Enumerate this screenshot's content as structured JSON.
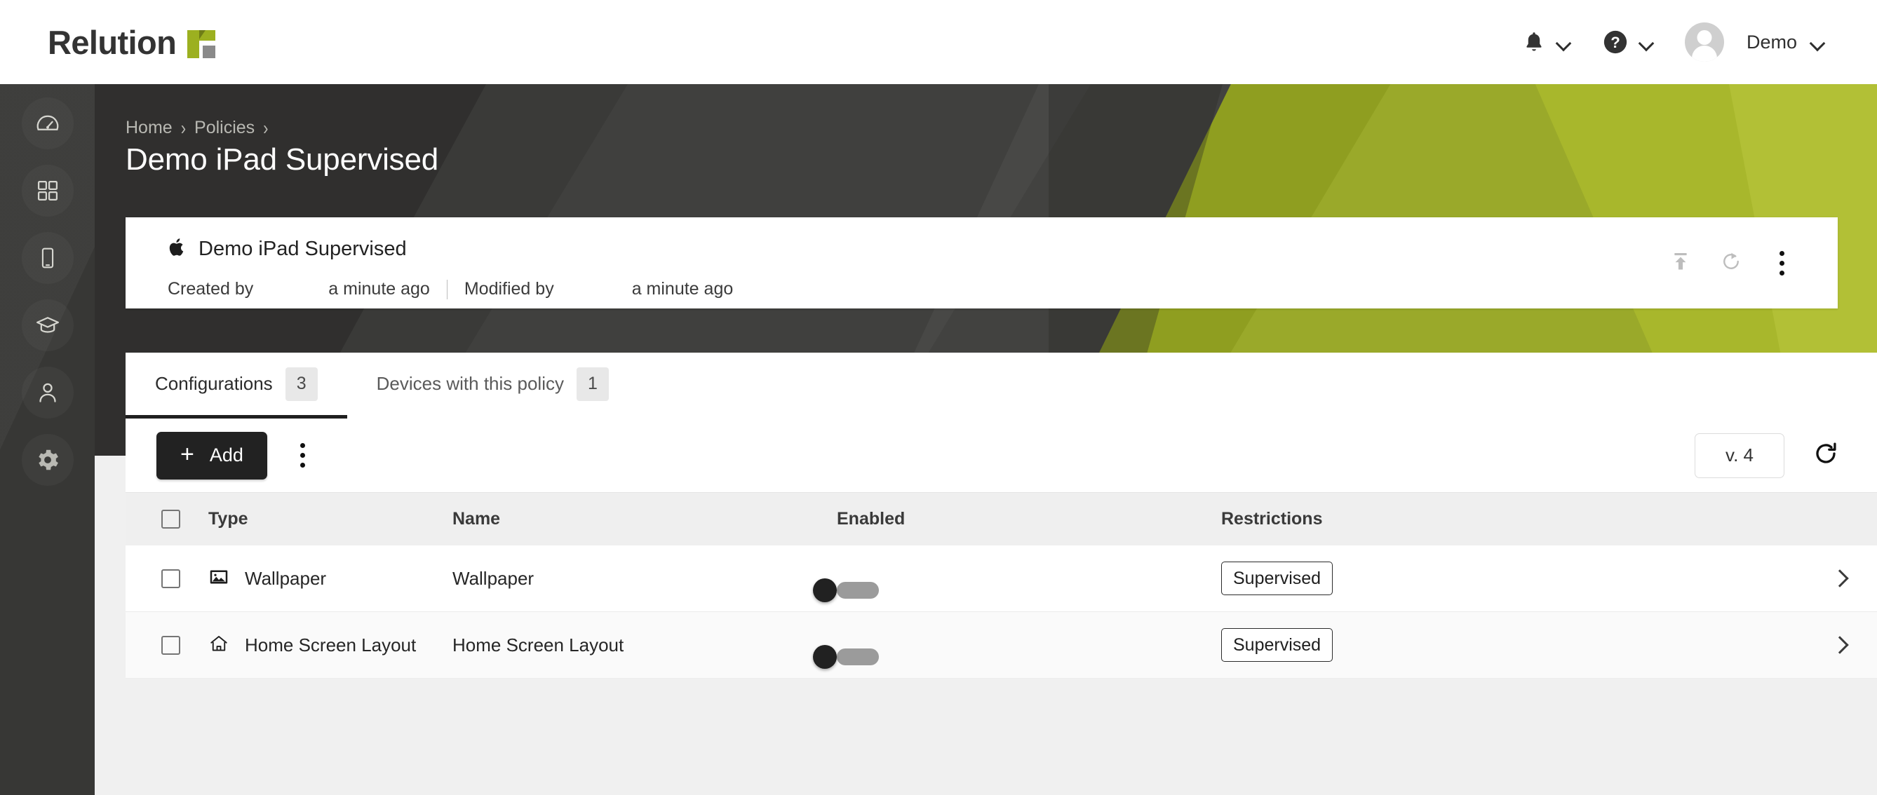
{
  "topbar": {
    "brand_name": "Relution",
    "brand_logo_icon": "relution-logo-mark",
    "notifications_icon": "bell-icon",
    "help_icon": "question-circle-icon",
    "chevron_icon": "chevron-down-icon",
    "avatar_icon": "user-avatar",
    "user_name": "Demo"
  },
  "sidebar": {
    "items": [
      {
        "name": "dashboard",
        "icon": "speedometer-icon",
        "active": false
      },
      {
        "name": "apps",
        "icon": "grid-apps-icon",
        "active": false
      },
      {
        "name": "devices",
        "icon": "mobile-device-icon",
        "active": false
      },
      {
        "name": "academy",
        "icon": "graduation-cap-icon",
        "active": false
      },
      {
        "name": "users",
        "icon": "person-icon",
        "active": false
      },
      {
        "name": "settings",
        "icon": "gear-icon",
        "active": true
      }
    ]
  },
  "hero": {
    "breadcrumb": [
      "Home",
      "Policies"
    ],
    "breadcrumb_separator": "›",
    "title": "Demo iPad Supervised"
  },
  "info_card": {
    "platform_icon": "apple-icon",
    "title": "Demo iPad Supervised",
    "created_by_label": "Created by",
    "created_by_value": "",
    "created_at": "a minute ago",
    "modified_by_label": "Modified by",
    "modified_by_value": "",
    "modified_at": "a minute ago",
    "actions": [
      {
        "name": "publish",
        "icon": "upload-icon",
        "disabled": true
      },
      {
        "name": "restore",
        "icon": "restore-icon",
        "disabled": true
      },
      {
        "name": "more",
        "icon": "kebab-icon",
        "disabled": false
      }
    ]
  },
  "tabs": [
    {
      "label": "Configurations",
      "count": "3",
      "active": true
    },
    {
      "label": "Devices with this policy",
      "count": "1",
      "active": false
    }
  ],
  "toolbar": {
    "add_label": "Add",
    "add_plus_icon": "plus-icon",
    "more_icon": "kebab-icon",
    "version_label": "v. 4",
    "refresh_icon": "refresh-icon"
  },
  "table": {
    "columns": [
      "Type",
      "Name",
      "Enabled",
      "Restrictions"
    ],
    "select_all_icon": "checkbox-unchecked-icon",
    "row_arrow_icon": "chevron-right-icon",
    "rows": [
      {
        "type": "Wallpaper",
        "type_icon": "image-picture-icon",
        "name": "Wallpaper",
        "enabled": true,
        "restriction": "Supervised"
      },
      {
        "type": "Home Screen Layout",
        "type_icon": "home-house-icon",
        "name": "Home Screen Layout",
        "enabled": true,
        "restriction": "Supervised"
      }
    ]
  },
  "colors": {
    "brand_green": "#9cb020",
    "hero_dark": "#3a3a38",
    "accent_dark": "#222222",
    "page_bg": "#f0f0f0"
  }
}
